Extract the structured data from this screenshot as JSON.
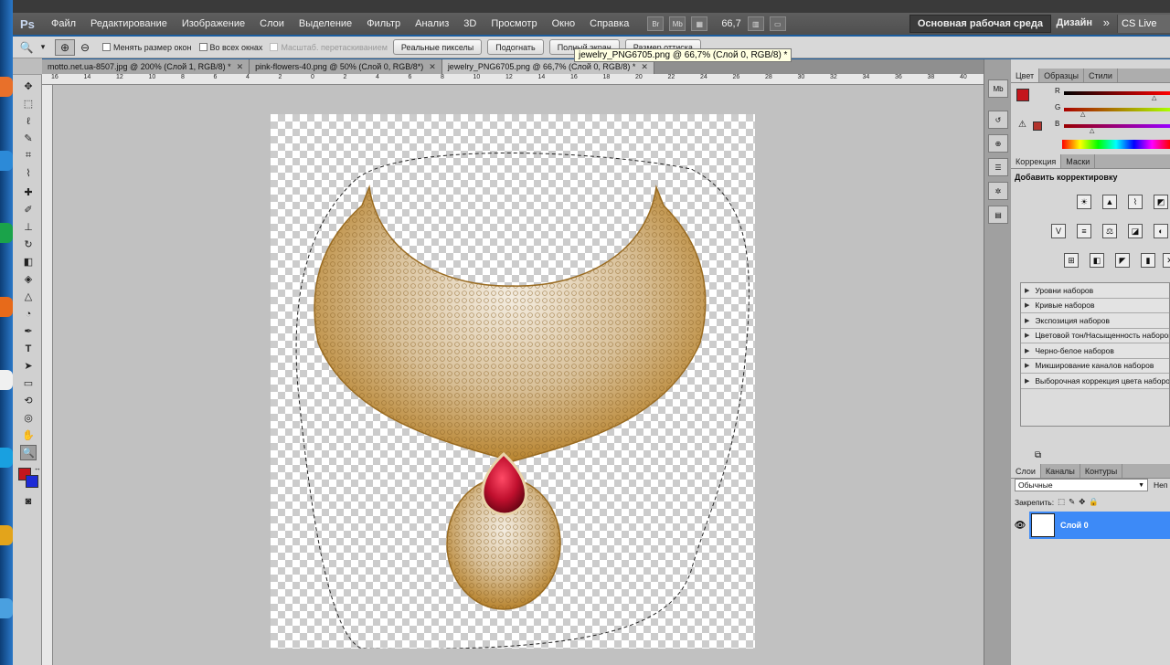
{
  "app": {
    "logo": "Ps"
  },
  "menu": {
    "items": [
      "Файл",
      "Редактирование",
      "Изображение",
      "Слои",
      "Выделение",
      "Фильтр",
      "Анализ",
      "3D",
      "Просмотр",
      "Окно",
      "Справка"
    ],
    "zoom": "66,7",
    "workspace": "Основная рабочая среда",
    "design": "Дизайн",
    "cslive": "CS Live"
  },
  "options": {
    "resize_windows": "Менять размер окон",
    "all_windows": "Во всех окнах",
    "scrubby": "Масштаб. перетаскиванием",
    "actual_pixels": "Реальные пикселы",
    "fit": "Подогнать",
    "fullscreen": "Полный экран",
    "print_size": "Размер оттиска"
  },
  "tooltip": "jewelry_PNG6705.png @ 66,7% (Слой 0, RGB/8) *",
  "tabs": [
    {
      "label": "motto.net.ua-8507.jpg @ 200% (Слой 1, RGB/8) *"
    },
    {
      "label": "pink-flowers-40.png @ 50% (Слой 0, RGB/8*)"
    },
    {
      "label": "jewelry_PNG6705.png @ 66,7% (Слой 0, RGB/8) *"
    }
  ],
  "ruler": [
    "16",
    "14",
    "12",
    "10",
    "8",
    "6",
    "4",
    "2",
    "0",
    "2",
    "4",
    "6",
    "8",
    "10",
    "12",
    "14",
    "16",
    "18",
    "20",
    "22",
    "24",
    "26",
    "28",
    "30",
    "32",
    "34",
    "36",
    "38",
    "40"
  ],
  "colors": {
    "foreground": "#c4161c",
    "background": "#1d2bd6",
    "selection": "#3d8af7"
  },
  "color_panel": {
    "tabs": [
      "Цвет",
      "Образцы",
      "Стили"
    ],
    "r": "R",
    "g": "G",
    "b": "B"
  },
  "adjust_panel": {
    "tabs": [
      "Коррекция",
      "Маски"
    ],
    "title": "Добавить корректировку",
    "presets": [
      "Уровни наборов",
      "Кривые наборов",
      "Экспозиция наборов",
      "Цветовой тон/Насыщенность наборов",
      "Черно-белое наборов",
      "Микширование каналов наборов",
      "Выборочная коррекция цвета наборов"
    ]
  },
  "layers_panel": {
    "tabs": [
      "Слои",
      "Каналы",
      "Контуры"
    ],
    "blend_mode": "Обычные",
    "opacity_label": "Неп",
    "lock_label": "Закрепить:",
    "layers": [
      {
        "name": "Слой 0"
      }
    ]
  }
}
